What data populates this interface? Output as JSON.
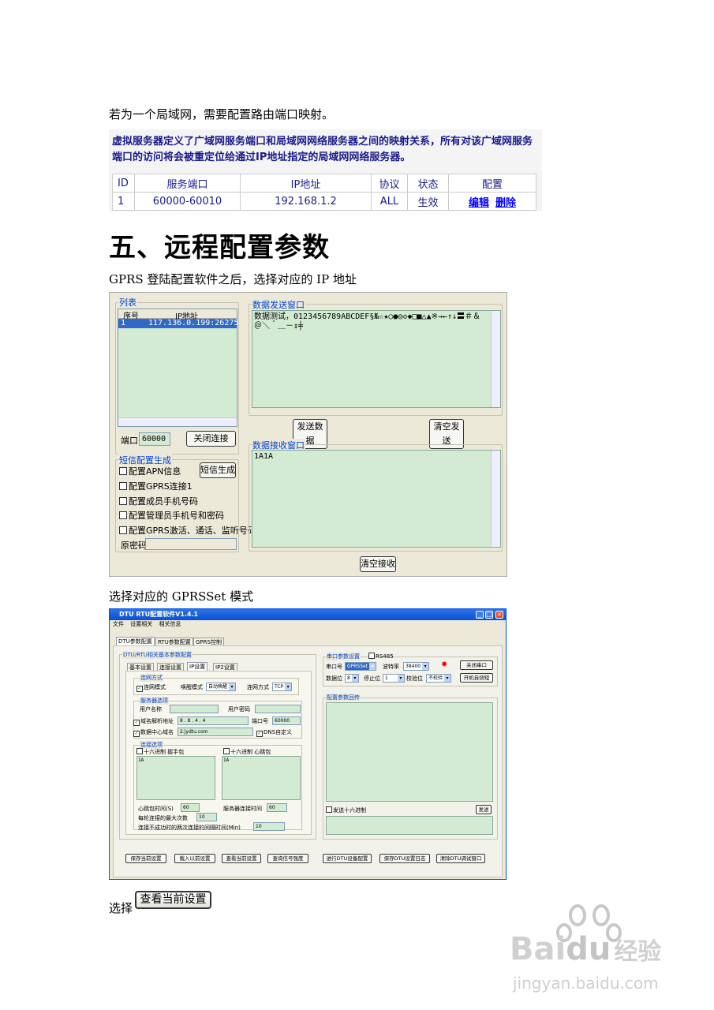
{
  "intro_text": "若为一个局域网，需要配置路由端口映射。",
  "router": {
    "desc": "虚拟服务器定义了广域网服务端口和局域网网络服务器之间的映射关系，所有对该广域网服务端口的访问将会被重定位给通过IP地址指定的局域网网络服务器。",
    "headers": [
      "ID",
      "服务端口",
      "IP地址",
      "协议",
      "状态",
      "配置"
    ],
    "row": {
      "id": "1",
      "port": "60000-60010",
      "ip": "192.168.1.2",
      "proto": "ALL",
      "status": "生效",
      "edit": "编辑",
      "del": "删除"
    }
  },
  "heading": "五、远程配置参数",
  "gprs_text": "GPRS 登陆配置软件之后，选择对应的 IP 地址",
  "win1": {
    "list_label": "列表",
    "col_no": "序号",
    "col_ip": "IP地址",
    "list_row": {
      "no": "1",
      "ip": "117.136.0.199:26275"
    },
    "port_label": "端口",
    "port_value": "60000",
    "close_btn": "关闭连接",
    "send_label": "数据发送窗口",
    "send_text": "数据测试，0123456789ABCDEF§№☆★○●◎◇◆□■△▲※→←↑↓〓＃＆＠＼＾＿－↕╪",
    "send_btn": "发送数据",
    "clear_send_btn": "清空发送",
    "recv_label": "数据接收窗口",
    "recv_text": "1A1A",
    "clear_recv_btn": "清空接收",
    "sms_label": "短信配置生成",
    "sms_btn": "短信生成",
    "sms_items": [
      "配置APN信息",
      "配置GPRS连接1",
      "配置成员手机号码",
      "配置管理员手机号和密码",
      "配置GPRS激活、通话、监听号码"
    ],
    "pwd_label": "原密码"
  },
  "mode_text": "选择对应的 GPRSSet 模式",
  "win2": {
    "title": "DTU RTU配置软件V1.4.1",
    "menu": [
      "文件",
      "设置相关",
      "相关信息"
    ],
    "tabs": [
      "DTU参数配置",
      "RTU参数配置",
      "GPRS控制"
    ],
    "group_basic": "DTU/RTU相关基本参数配置",
    "subtabs": [
      "基本设置",
      "连接设置",
      "IP设置",
      "IP2设置"
    ],
    "conn_mode_label": "连网方式",
    "conn_always": "连网模式",
    "wake_mode": "唤醒模式",
    "wake_value": "自动唤醒",
    "net_mode": "连网方式",
    "net_value": "TCP",
    "server_label": "服务器选项",
    "user_name": "用户名称",
    "user_pwd": "用户密码",
    "dns_chk": "域名解析地址",
    "dns_ip": "8  .  8  .  4  .  4",
    "port_lbl": "端口号",
    "port_val": "60000",
    "center_chk": "数据中心域名",
    "center_val": "2.jydtu.com",
    "dnsdef_chk": "DNS自定义",
    "conn_opt_label": "连接选项",
    "hex1": "十六进制",
    "handshake": "握手包",
    "hex2": "十六进制",
    "heartbeat": "心跳包",
    "ta1": "1A",
    "ta2": "1A",
    "hb_time": "心跳包时间(S)",
    "hb_val": "60",
    "srv_time": "服务器连接时间",
    "srv_val": "60",
    "retry": "每轮连接的最大次数",
    "retry_val": "10",
    "interval": "连接不成功时的两次连接的间隔时间(Min)",
    "interval_val": "10",
    "serial_label": "串口参数设置",
    "rs485": "RS485",
    "com_lbl": "串口号",
    "com_val": "GPRSSet",
    "baud_lbl": "波特率",
    "baud_val": "38400",
    "close_com": "关闭串口",
    "data_lbl": "数据位",
    "data_val": "8",
    "stop_lbl": "停止位",
    "stop_val": "1",
    "parity_lbl": "校验位",
    "parity_val": "不校验",
    "boot_btn": "开机自烧短",
    "cfg_label": "配置参数回传",
    "send_hex": "发送十六进制",
    "send_btn": "发送",
    "bottom_btns": [
      "保存当前设置",
      "载入以前设置",
      "查看当前设置",
      "查询信号强度",
      "进行DTU设备配置",
      "保存DTU设置日志",
      "清除DTU调试窗口"
    ]
  },
  "select_text": "选择",
  "select_btn": "查看当前设置",
  "watermark": {
    "brand": "Bai",
    "du": "du",
    "cn": "经验",
    "url": "jingyan.baidu.com"
  }
}
